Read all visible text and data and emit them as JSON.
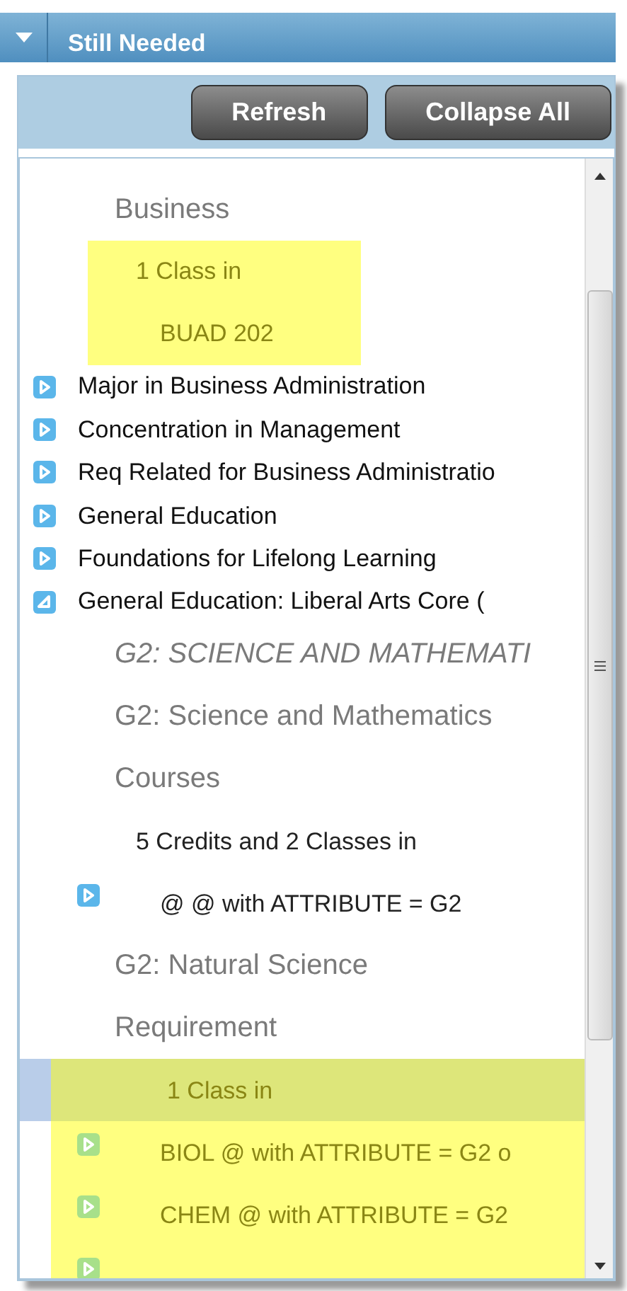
{
  "header": {
    "title": "Still Needed",
    "expanded": true
  },
  "toolbar": {
    "buttons": [
      "Refresh",
      "Collapse All"
    ]
  },
  "items": [
    {
      "kind": "heading",
      "text": "Business",
      "italic": false
    },
    {
      "kind": "highlight",
      "children": [
        {
          "kind": "rule",
          "text": "1 Class in",
          "selected": false
        },
        {
          "kind": "course",
          "text": "BUAD 202",
          "icon": false
        }
      ]
    },
    {
      "kind": "block",
      "text": "Major in Business Administration",
      "expanded": false
    },
    {
      "kind": "block",
      "text": "Concentration in Management",
      "expanded": false
    },
    {
      "kind": "block",
      "text": "Req Related for Business Administratio",
      "expanded": false
    },
    {
      "kind": "block",
      "text": "General Education",
      "expanded": false
    },
    {
      "kind": "block",
      "text": "Foundations for Lifelong Learning",
      "expanded": false
    },
    {
      "kind": "block",
      "text": "General Education: Liberal Arts Core (",
      "expanded": true
    },
    {
      "kind": "heading",
      "text": "G2: SCIENCE AND MATHEMATI",
      "italic": true
    },
    {
      "kind": "heading",
      "text": "G2: Science and Mathematics",
      "italic": false
    },
    {
      "kind": "heading",
      "text": "Courses",
      "italic": false
    },
    {
      "kind": "rule",
      "text": "5 Credits and 2 Classes in",
      "selected": false
    },
    {
      "kind": "course",
      "text": "@ @ with ATTRIBUTE = G2",
      "icon": true
    },
    {
      "kind": "heading",
      "text": "G2: Natural Science",
      "italic": false
    },
    {
      "kind": "heading",
      "text": "Requirement",
      "italic": false
    },
    {
      "kind": "highlight",
      "children": [
        {
          "kind": "rule",
          "text": "1 Class in",
          "selected": true
        },
        {
          "kind": "course",
          "text": "BIOL @ with ATTRIBUTE = G2 o",
          "icon": true
        },
        {
          "kind": "course",
          "text": "CHEM @ with ATTRIBUTE = G2",
          "icon": true
        },
        {
          "kind": "course",
          "icon": true
        }
      ]
    }
  ]
}
